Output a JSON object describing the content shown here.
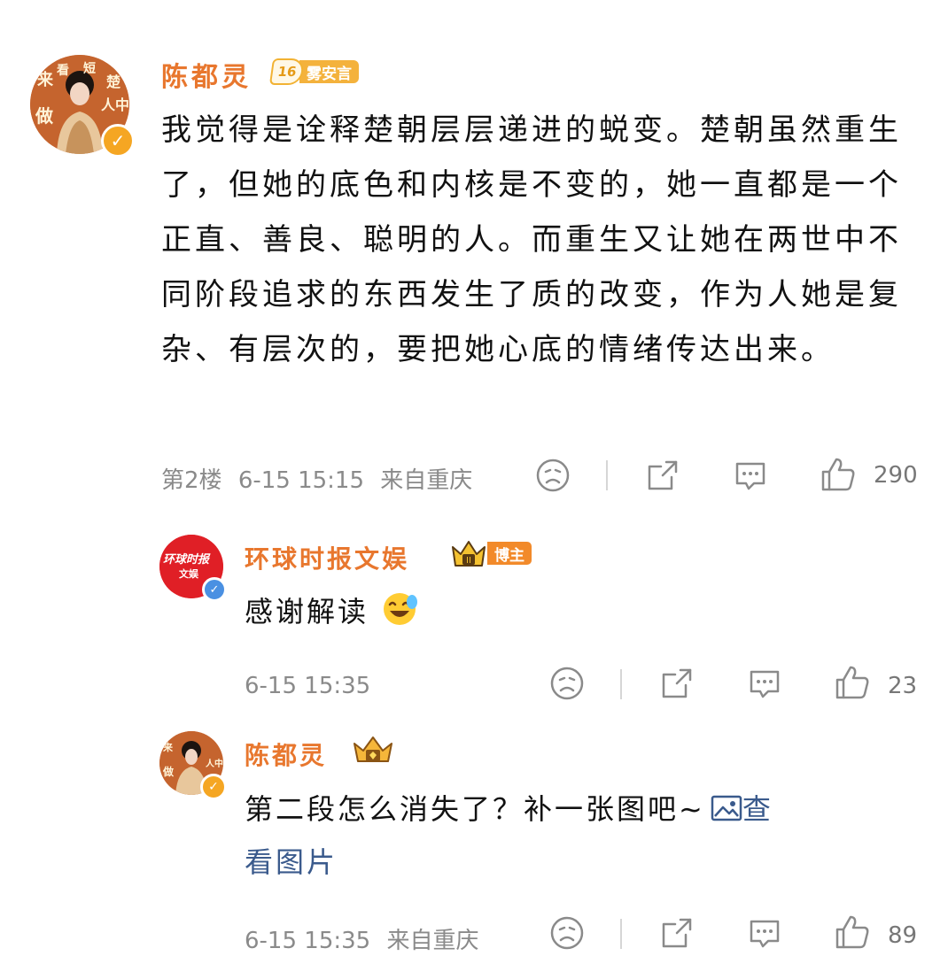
{
  "comments": [
    {
      "username": "陈都灵",
      "level": "16",
      "fan_badge": "雾安言",
      "avatar_text": [
        "来",
        "看",
        "短",
        "楚",
        "做",
        "人",
        "中"
      ],
      "text": "我觉得是诠释楚朝层层递进的蜕变。楚朝虽然重生了，但她的底色和内核是不变的，她一直都是一个正直、善良、聪明的人。而重生又让她在两世中不同阶段追求的东西发生了质的改变，作为人她是复杂、有层次的，要把她心底的情绪传达出来。",
      "floor": "第2楼",
      "time": "6-15 15:15",
      "location": "来自重庆",
      "likes": "290"
    },
    {
      "username": "环球时报文娱",
      "role_badge": "博主",
      "avatar_text": "环球时报",
      "avatar_sub": "文娱",
      "text": "感谢解读",
      "time": "6-15 15:35",
      "likes": "23"
    },
    {
      "username": "陈都灵",
      "text": "第二段怎么消失了？补一张图吧~",
      "link_text_1": "查",
      "link_text_2": "看图片",
      "time": "6-15 15:35",
      "location": "来自重庆",
      "likes": "89"
    }
  ],
  "colors": {
    "username": "#e8772e",
    "meta": "#8a8a8a",
    "verified": "#f5a623",
    "link": "#3a5a8c"
  }
}
